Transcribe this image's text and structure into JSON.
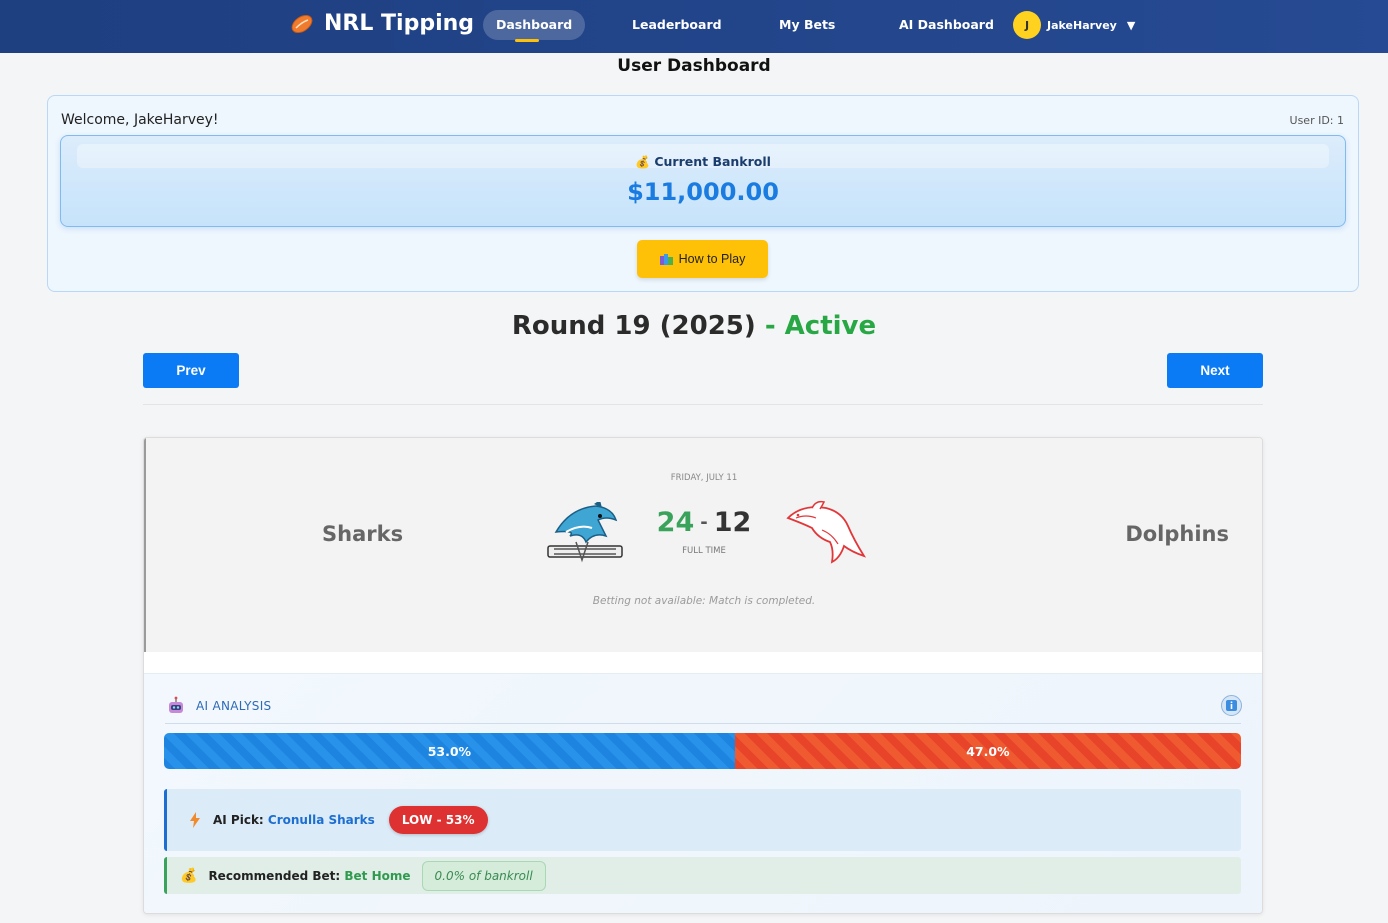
{
  "app": {
    "title": "NRL Tipping"
  },
  "nav": {
    "items": [
      {
        "label": "Dashboard",
        "active": true
      },
      {
        "label": "Leaderboard"
      },
      {
        "label": "My Bets"
      },
      {
        "label": "AI Dashboard"
      }
    ],
    "user": {
      "initial": "J",
      "name": "JakeHarvey"
    }
  },
  "page": {
    "title": "User Dashboard"
  },
  "welcome": {
    "message": "Welcome, JakeHarvey!",
    "user_id": "User ID: 1",
    "bankroll_label": "Current Bankroll",
    "bankroll_value": "$11,000.00",
    "how_to_play_label": "How to Play"
  },
  "round": {
    "title": "Round 19 (2025)",
    "status": " - Active",
    "prev_label": "Prev",
    "next_label": "Next"
  },
  "match": {
    "date": "FRIDAY, JULY 11",
    "home_team": "Sharks",
    "away_team": "Dolphins",
    "home_score": "24",
    "separator": "-",
    "away_score": "12",
    "status": "FULL TIME",
    "betting_note": "Betting not available: Match is completed."
  },
  "ai": {
    "title": "AI ANALYSIS",
    "home_prob": 0.53,
    "home_prob_label": "53.0%",
    "away_prob_label": "47.0%",
    "pick_label": "AI Pick:",
    "pick_team": "Cronulla Sharks",
    "confidence": "LOW - 53%",
    "rec_label": "Recommended Bet:",
    "rec_value": "Bet Home",
    "bankroll_pct": "0.0% of bankroll"
  },
  "colors": {
    "nav_bg": "#1e3f80",
    "accent_blue": "#0b7bf5",
    "active_green": "#28a745",
    "warning_yellow": "#ffc107",
    "home_bar": "#1d85e0",
    "away_bar": "#e8442a",
    "badge_red": "#de3232"
  },
  "icons": {
    "brand": "rugby-ball-icon",
    "bankroll": "money-bag-icon",
    "how_to_play": "books-icon",
    "ai": "robot-icon",
    "info": "info-icon",
    "pick": "lightning-bolt-icon",
    "recommended": "money-bag-icon"
  }
}
